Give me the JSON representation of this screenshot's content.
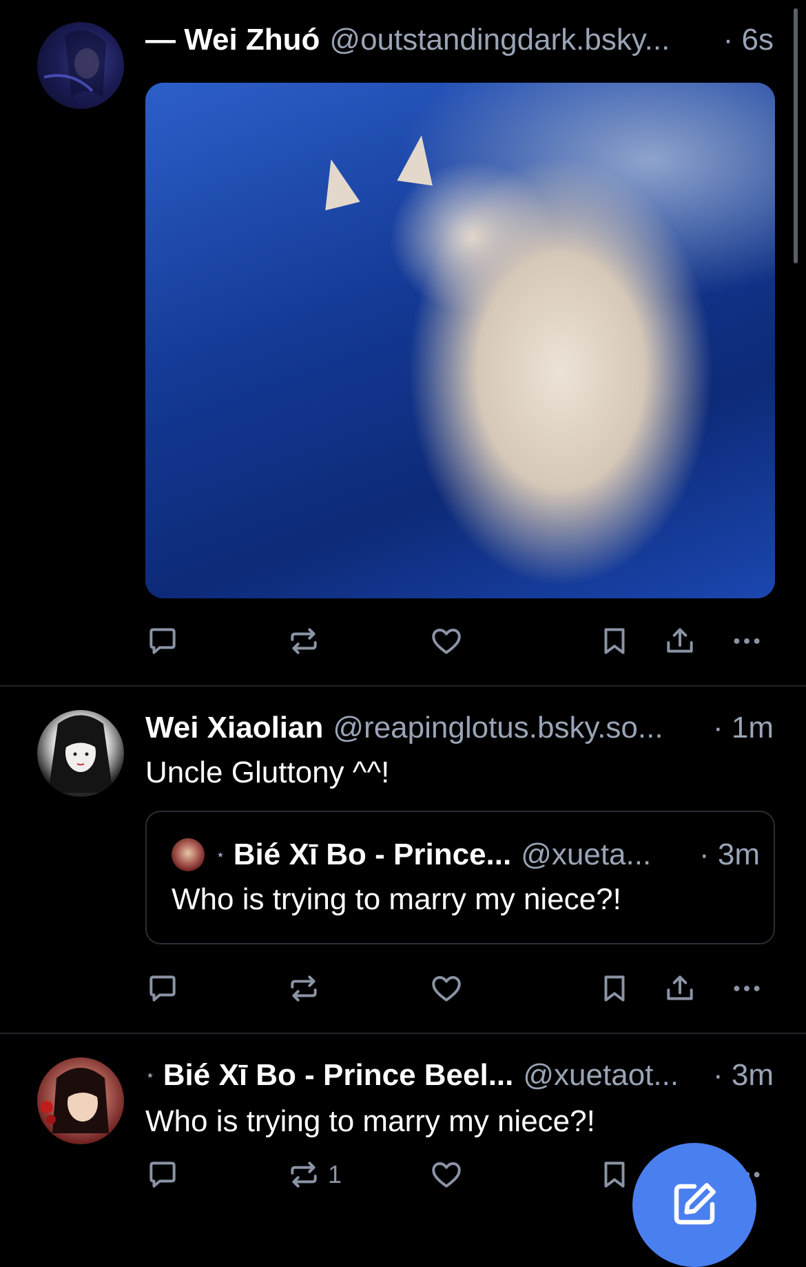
{
  "posts": [
    {
      "prefix": "— ",
      "name": "Wei Zhuó",
      "handle": "@outstandingdark.bsky...",
      "time": "· 6s",
      "avatar_icon": "avatar-image",
      "media": "cat-gif"
    },
    {
      "name": "Wei Xiaolian",
      "handle": "@reapinglotus.bsky.so...",
      "time": "· 1m",
      "text": "Uncle Gluttony ^^!",
      "quote": {
        "name": "Bié Xī Bo - Prince...",
        "handle": "@xueta...",
        "time": "· 3m",
        "text": "Who is trying to marry my niece?!"
      }
    },
    {
      "name": "Bié Xī Bo - Prince Beel...",
      "handle": "@xuetaot...",
      "time": "· 3m",
      "text": "Who is trying to marry my niece?!",
      "repost_count": "1"
    }
  ],
  "star_glyph": "⋆",
  "colors": {
    "background": "#000000",
    "muted_text": "#9aa4b6",
    "icon": "#8b94a5",
    "divider": "#1f2228",
    "fab": "#4a7ff0"
  },
  "icons": [
    "reply-icon",
    "repost-icon",
    "like-icon",
    "bookmark-icon",
    "share-icon",
    "more-icon",
    "compose-icon"
  ]
}
